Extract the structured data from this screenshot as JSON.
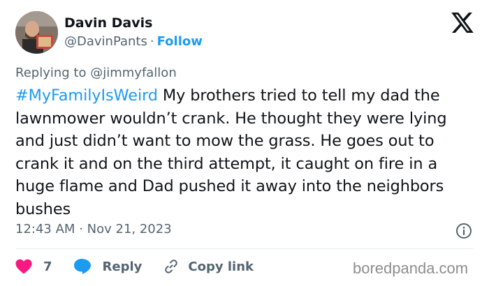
{
  "author": {
    "name": "Davin Davis",
    "handle": "@DavinPants",
    "separator": "·",
    "follow_label": "Follow"
  },
  "platform_icon": "x-logo-icon",
  "replying": {
    "prefix": "Replying to",
    "target": "@jimmyfallon"
  },
  "tweet": {
    "hashtag": "#MyFamilyIsWeird",
    "text": " My brothers tried to tell my dad the lawnmower wouldn’t crank. He thought they were lying and just didn’t want to mow the grass. He goes out to crank it and on the third attempt, it caught on fire in a huge flame and Dad pushed it away into the neighbors bushes"
  },
  "meta": {
    "time": "12:43 AM",
    "separator": "·",
    "date": "Nov 21, 2023"
  },
  "actions": {
    "like_count": "7",
    "reply_label": "Reply",
    "copy_label": "Copy link"
  },
  "watermark": "boredpanda.com",
  "colors": {
    "accent": "#1d9bf0",
    "like": "#f91880",
    "text": "#0f1419",
    "muted": "#536471"
  }
}
